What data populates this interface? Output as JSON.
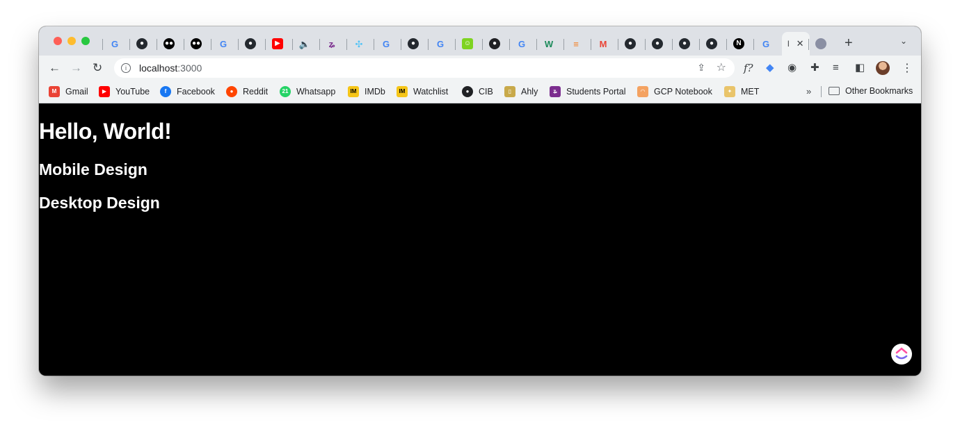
{
  "browser": {
    "tabs": [
      {
        "icon": "google-icon",
        "color": "#4285f4",
        "glyph": "G"
      },
      {
        "icon": "github-icon",
        "color": "#24292f",
        "glyph": "●"
      },
      {
        "icon": "medium-icon",
        "color": "#000000",
        "glyph": "●●"
      },
      {
        "icon": "medium-icon",
        "color": "#000000",
        "glyph": "●●"
      },
      {
        "icon": "google-icon",
        "color": "#4285f4",
        "glyph": "G"
      },
      {
        "icon": "github-icon",
        "color": "#24292f",
        "glyph": "●"
      },
      {
        "icon": "youtube-icon",
        "color": "#ff0000",
        "glyph": "▶"
      },
      {
        "icon": "audio-icon",
        "color": "#3c4043",
        "glyph": "🔈"
      },
      {
        "icon": "students-portal-icon",
        "color": "#7b2d8e",
        "glyph": "ʑ"
      },
      {
        "icon": "puzzle-icon",
        "color": "#4fc3f7",
        "glyph": "✣"
      },
      {
        "icon": "google-icon",
        "color": "#4285f4",
        "glyph": "G"
      },
      {
        "icon": "github-icon",
        "color": "#24292f",
        "glyph": "●"
      },
      {
        "icon": "google-icon",
        "color": "#4285f4",
        "glyph": "G"
      },
      {
        "icon": "smiley-icon",
        "color": "#7ed321",
        "glyph": "☺"
      },
      {
        "icon": "globe-icon",
        "color": "#202124",
        "glyph": "●"
      },
      {
        "icon": "google-icon",
        "color": "#4285f4",
        "glyph": "G"
      },
      {
        "icon": "w-icon",
        "color": "#1b8a5a",
        "glyph": "W"
      },
      {
        "icon": "stackoverflow-icon",
        "color": "#f48024",
        "glyph": "≡"
      },
      {
        "icon": "gmail-icon",
        "color": "#ea4335",
        "glyph": "M"
      },
      {
        "icon": "github-icon",
        "color": "#24292f",
        "glyph": "●"
      },
      {
        "icon": "github-icon",
        "color": "#24292f",
        "glyph": "●"
      },
      {
        "icon": "github-icon",
        "color": "#24292f",
        "glyph": "●"
      },
      {
        "icon": "github-icon",
        "color": "#24292f",
        "glyph": "●"
      },
      {
        "icon": "nextjs-icon",
        "color": "#000000",
        "glyph": "N"
      },
      {
        "icon": "google-icon",
        "color": "#4285f4",
        "glyph": "G"
      }
    ],
    "active_tab": {
      "title": "l",
      "close": "✕"
    },
    "new_tab": "+",
    "tab_search": "⌄",
    "address": {
      "host": "localhost",
      "port": ":3000"
    },
    "extensions": [
      {
        "name": "function-icon",
        "glyph": "f?"
      },
      {
        "name": "tag-icon",
        "glyph": "◆"
      },
      {
        "name": "incognito-icon",
        "glyph": "◉"
      },
      {
        "name": "puzzle-icon",
        "glyph": "✚"
      },
      {
        "name": "reading-list-icon",
        "glyph": "≡"
      },
      {
        "name": "side-panel-icon",
        "glyph": "◧"
      }
    ]
  },
  "bookmarks": [
    {
      "label": "Gmail",
      "icon": "gmail-icon",
      "color": "#ea4335",
      "glyph": "M"
    },
    {
      "label": "YouTube",
      "icon": "youtube-icon",
      "color": "#ff0000",
      "glyph": "▶"
    },
    {
      "label": "Facebook",
      "icon": "facebook-icon",
      "color": "#1877f2",
      "glyph": "f"
    },
    {
      "label": "Reddit",
      "icon": "reddit-icon",
      "color": "#ff4500",
      "glyph": "●"
    },
    {
      "label": "Whatsapp",
      "icon": "whatsapp-icon",
      "color": "#25d366",
      "glyph": "21"
    },
    {
      "label": "IMDb",
      "icon": "imdb-icon",
      "color": "#f5c518",
      "glyph": "IM"
    },
    {
      "label": "Watchlist",
      "icon": "imdb-icon",
      "color": "#f5c518",
      "glyph": "IM"
    },
    {
      "label": "CIB",
      "icon": "globe-icon",
      "color": "#202124",
      "glyph": "●"
    },
    {
      "label": "Ahly",
      "icon": "ahly-icon",
      "color": "#c8a94a",
      "glyph": "▯"
    },
    {
      "label": "Students Portal",
      "icon": "students-portal-icon",
      "color": "#7b2d8e",
      "glyph": "ʑ"
    },
    {
      "label": "GCP Notebook",
      "icon": "gcp-icon",
      "color": "#f4a261",
      "glyph": "◠"
    },
    {
      "label": "MET",
      "icon": "met-icon",
      "color": "#e9c46a",
      "glyph": "✦"
    }
  ],
  "bookmarks_overflow": "»",
  "other_bookmarks": "Other Bookmarks",
  "page": {
    "heading": "Hello, World!",
    "mobile_heading": "Mobile Design",
    "desktop_heading": "Desktop Design"
  }
}
